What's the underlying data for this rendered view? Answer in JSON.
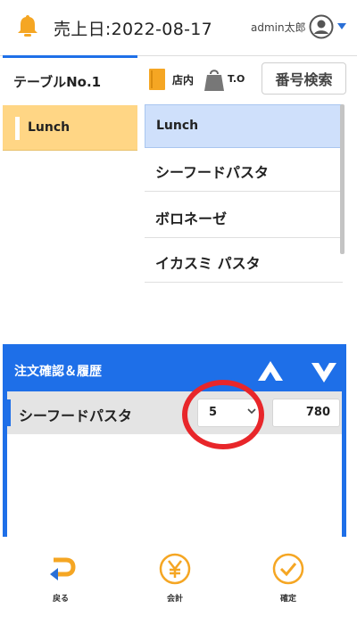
{
  "header": {
    "sales_date": "売上日:2022-08-17",
    "user": "admin太郎"
  },
  "left": {
    "table_label": "テーブルNo.1",
    "category": "Lunch"
  },
  "toolbar": {
    "shop_in": "店内",
    "take_out": "T.O",
    "search": "番号検索"
  },
  "menu": {
    "header": "Lunch",
    "items": [
      "シーフードパスタ",
      "ボロネーゼ",
      "イカスミ パスタ"
    ]
  },
  "order": {
    "title": "注文確認＆履歴",
    "item_name": "シーフードパスタ",
    "quantity": "5",
    "price": "780"
  },
  "footer": {
    "back": "戻る",
    "checkout": "会計",
    "confirm": "確定"
  },
  "colors": {
    "accent": "#1e6fe8",
    "bell": "#f5a623",
    "category_bg": "#ffd685",
    "highlight": "#e8262a"
  }
}
